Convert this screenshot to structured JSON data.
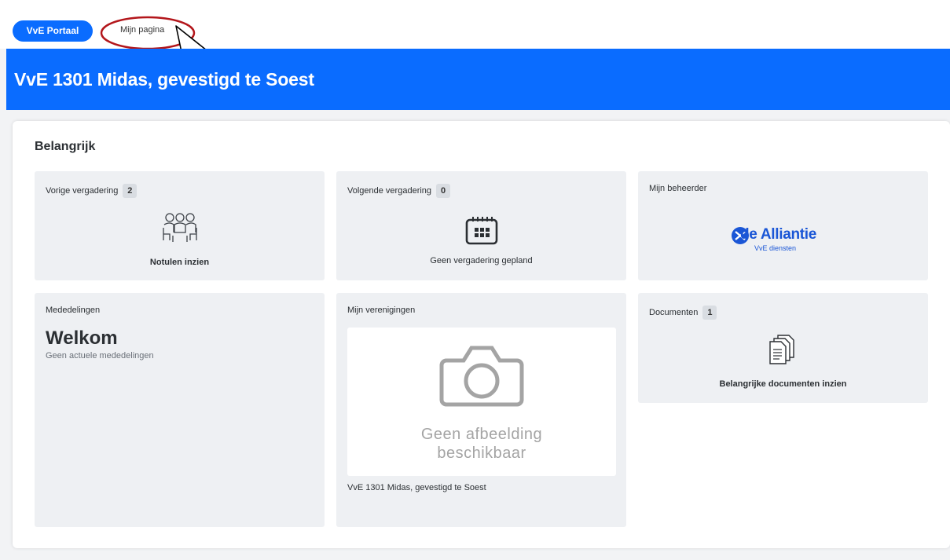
{
  "nav": {
    "portal_label": "VvE Portaal",
    "my_page_label": "Mijn pagina"
  },
  "banner": {
    "title": "VvE 1301 Midas, gevestigd te Soest"
  },
  "section": {
    "title": "Belangrijk"
  },
  "cards": {
    "prev_meeting": {
      "label": "Vorige vergadering",
      "count": "2",
      "action": "Notulen inzien",
      "icon": "people-meeting-icon"
    },
    "next_meeting": {
      "label": "Volgende vergadering",
      "count": "0",
      "status": "Geen vergadering gepland",
      "icon": "calendar-icon"
    },
    "manager": {
      "label": "Mijn beheerder",
      "logo_name": "de Alliantie",
      "logo_sub": "VvE diensten",
      "icon": "de-alliantie-logo"
    },
    "announcements": {
      "label": "Mededelingen",
      "headline": "Welkom",
      "status": "Geen actuele mededelingen"
    },
    "associations": {
      "label": "Mijn verenigingen",
      "placeholder_line1": "Geen afbeelding",
      "placeholder_line2": "beschikbaar",
      "name": "VvE 1301 Midas, gevestigd te Soest",
      "icon": "camera-icon"
    },
    "documents": {
      "label": "Documenten",
      "count": "1",
      "action": "Belangrijke documenten inzien",
      "icon": "documents-icon"
    }
  },
  "colors": {
    "accent": "#0a6cff",
    "card_bg": "#eef0f3",
    "page_bg": "#f2f3f5",
    "logo_blue": "#1a56d6",
    "annotation_red": "#b3161b"
  }
}
